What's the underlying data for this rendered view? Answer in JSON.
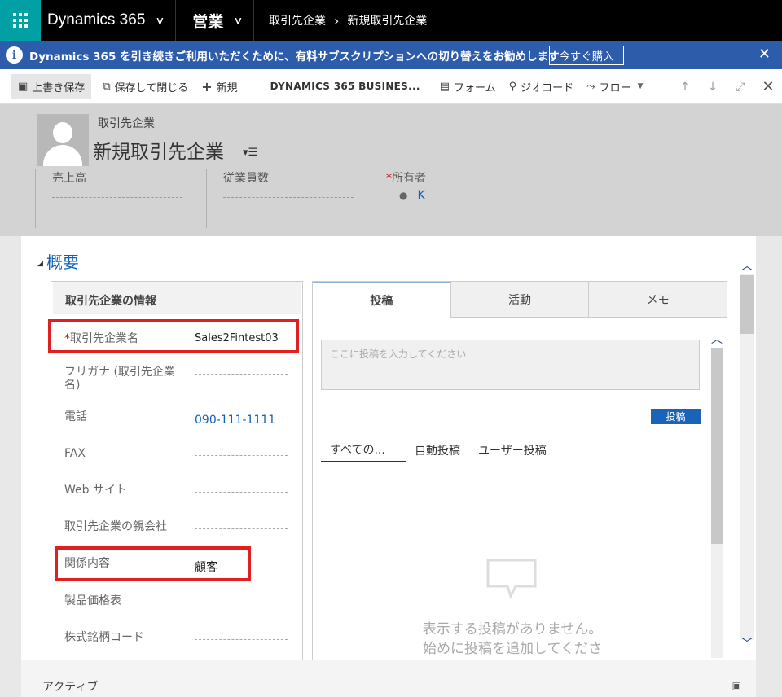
{
  "topnav": {
    "app_name": "Dynamics 365",
    "area": "営業",
    "breadcrumb": [
      "取引先企業",
      "新規取引先企業"
    ]
  },
  "notification": {
    "text": "Dynamics 365 を引き続きご利用いただくために、有料サブスクリプションへの切り替えをお勧めします",
    "button": "今すぐ購入"
  },
  "commands": {
    "save": "上書き保存",
    "save_close": "保存して閉じる",
    "new": "新規",
    "business": "DYNAMICS 365 BUSINES...",
    "form": "フォーム",
    "geocode": "ジオコード",
    "flow": "フロー"
  },
  "header": {
    "entity_type": "取引先企業",
    "title": "新規取引先企業",
    "fields": [
      {
        "label": "売上高"
      },
      {
        "label": "従業員数"
      },
      {
        "label": "所有者",
        "value": "K"
      }
    ]
  },
  "section": {
    "title": "概要",
    "info_header": "取引先企業の情報",
    "fields": [
      {
        "label": "取引先企業名",
        "value": "Sales2Fintest03",
        "required": true
      },
      {
        "label": "フリガナ (取引先企業名)",
        "value": ""
      },
      {
        "label": "電話",
        "value": "090-111-1111"
      },
      {
        "label": "FAX",
        "value": ""
      },
      {
        "label": "Web サイト",
        "value": ""
      },
      {
        "label": "取引先企業の親会社",
        "value": ""
      },
      {
        "label": "関係内容",
        "value": "顧客"
      },
      {
        "label": "製品価格表",
        "value": ""
      },
      {
        "label": "株式銘柄コード",
        "value": ""
      }
    ]
  },
  "activity": {
    "tabs": [
      "投稿",
      "活動",
      "メモ"
    ],
    "post_placeholder": "ここに投稿を入力してください",
    "post_button": "投稿",
    "subtabs": [
      "すべての...",
      "自動投稿",
      "ユーザー投稿"
    ],
    "empty_line1": "表示する投稿がありません。",
    "empty_line2": "始めに投稿を追加してくださ"
  },
  "footer": {
    "status": "アクティブ"
  }
}
